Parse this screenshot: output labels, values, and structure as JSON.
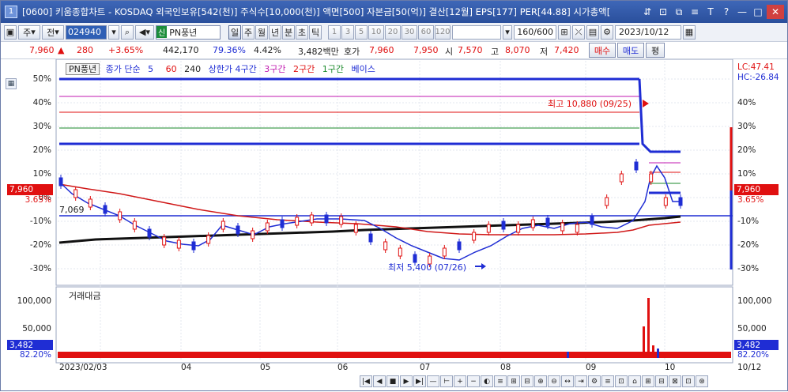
{
  "window": {
    "number": "1",
    "title": "[0600] 키움종합차트 - KOSDAQ 외국인보유[542(천)] 주식수[10,000(천)] 액면[500] 자본금[50(억)] 결산[12월] EPS[177] PER[44.88] 시가총액[",
    "title_icons": [
      "link-icon",
      "copy-icon",
      "window-icon",
      "text-icon",
      "font-size-icon",
      "help-icon",
      "minimize-icon",
      "maximize-icon",
      "close-icon"
    ],
    "title_icon_glyphs": [
      "⇵",
      "⊡",
      "⧉",
      "≡",
      "T",
      "?",
      "—",
      "□",
      "✕"
    ]
  },
  "toolbar": {
    "market_label": "주",
    "type_label": "전",
    "code_value": "024940",
    "stock_tag": "신",
    "stock_name": "PN풍년",
    "periods": [
      "일",
      "주",
      "월",
      "년",
      "분",
      "초",
      "틱"
    ],
    "active_period": "일",
    "minute_options": [
      "1",
      "3",
      "5",
      "10",
      "20",
      "30",
      "60",
      "120"
    ],
    "count_value": "160/600",
    "date_value": "2023/10/12"
  },
  "pricebar": {
    "price": "7,960",
    "arrow": "▲",
    "change": "280",
    "change_pct": "+3.65%",
    "volume": "442,170",
    "ratio1": "79.36%",
    "ratio2": "4.42%",
    "amount": "3,482백만",
    "quote_label": "호가",
    "quote_value": "7,960",
    "quote_value2": "7,950",
    "open_label": "시",
    "open_value": "7,570",
    "high_label": "고",
    "high_value": "8,070",
    "low_label": "저",
    "low_value": "7,420",
    "buy_label": "매수",
    "sell_label": "매도",
    "eval_label": "평"
  },
  "legend": {
    "stock": "PN풍년",
    "ma_label": "종가 단순",
    "ma5": "5",
    "ma60": "60",
    "ma240": "240",
    "limit_label": "상한가 4구간",
    "zone3": "3구간",
    "zone2": "2구간",
    "zone1": "1구간",
    "base": "베이스"
  },
  "axes": {
    "left_pct": [
      "50%",
      "40%",
      "30%",
      "20%",
      "10%",
      "0%",
      "-10%",
      "-20%",
      "-30%"
    ],
    "right_pct": [
      "40%",
      "30%",
      "20%",
      "10%",
      "-10%",
      "-20%",
      "-30%"
    ],
    "lc": "LC:47.41",
    "hc": "HC:-26.84",
    "price_tag": "7,960",
    "price_tag_pct": "3.65%",
    "left_price_tag_pct": "3.65%",
    "base_price_label": "7,069",
    "vol_left": [
      "100,000",
      "50,000"
    ],
    "vol_right": [
      "100,000",
      "50,000"
    ],
    "vol_tag": "3,482",
    "vol_tag_pct": "82.20%",
    "volume_title": "거래대금",
    "x_labels": [
      "2023/02/03",
      "04",
      "05",
      "06",
      "07",
      "08",
      "09",
      "10",
      "10/12"
    ]
  },
  "annotations": {
    "high": "최고 10,880 (09/25)",
    "low": "최저 5,400 (07/26)"
  },
  "bottom_controls": [
    "|◀",
    "◀",
    "■",
    "▶",
    "▶|",
    "—",
    "⊢",
    "+",
    "−",
    "◐",
    "≡",
    "⊞",
    "⊟",
    "⊕",
    "⊖",
    "↔",
    "⇥",
    "⚙",
    "≡",
    "⊡",
    "⌂",
    "⊞",
    "⊟",
    "⊠",
    "⊡",
    "⊛"
  ]
}
